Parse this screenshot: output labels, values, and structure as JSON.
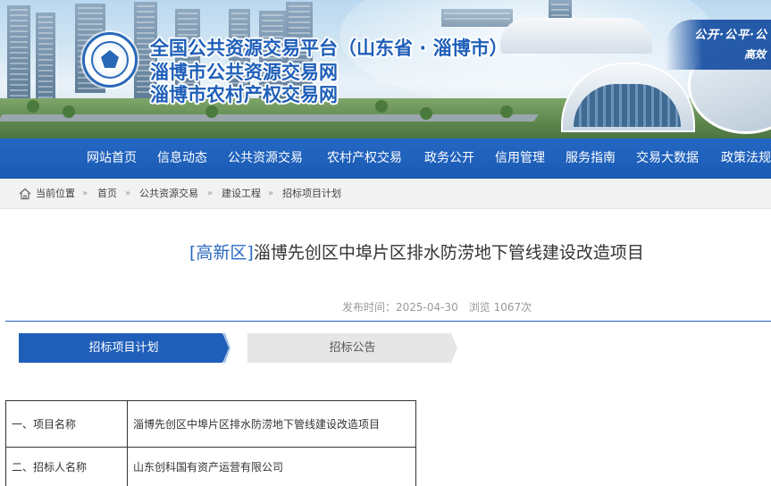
{
  "header": {
    "title_line1": "全国公共资源交易平台（山东省 · 淄博市）",
    "title_line2": "淄博市公共资源交易网",
    "title_line3": "淄博市农村产权交易网",
    "slogan_top": "公开·公平·公",
    "slogan_bottom": "高效"
  },
  "nav": {
    "items": [
      "网站首页",
      "信息动态",
      "公共资源交易",
      "农村产权交易",
      "政务公开",
      "信用管理",
      "服务指南",
      "交易大数据",
      "政策法规"
    ]
  },
  "breadcrumb": {
    "location_label": "当前位置",
    "items": [
      "首页",
      "公共资源交易",
      "建设工程",
      "招标项目计划"
    ],
    "separator": "»"
  },
  "article": {
    "tag": "[高新区]",
    "title": "淄博先创区中埠片区排水防涝地下管线建设改造项目",
    "publish_time": "发布时间：2025-04-30",
    "views": "浏览 1067次"
  },
  "tabs": [
    {
      "label": "招标项目计划",
      "active": true
    },
    {
      "label": "招标公告",
      "active": false
    }
  ],
  "table": {
    "rows": [
      {
        "label": "一、项目名称",
        "value": "淄博先创区中埠片区排水防涝地下管线建设改造项目"
      },
      {
        "label": "二、招标人名称",
        "value": "山东创科国有资产运营有限公司"
      }
    ]
  },
  "colors": {
    "brand_blue": "#1f5fb9",
    "nav_blue": "#2468c4",
    "tag_blue": "#2a68c2"
  }
}
